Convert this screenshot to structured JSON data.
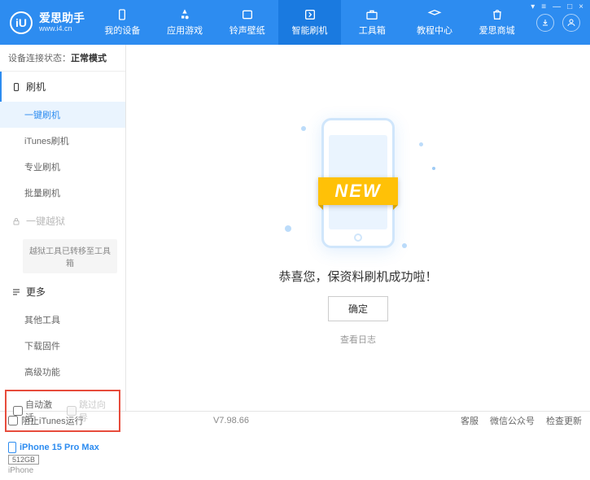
{
  "header": {
    "logo_name": "爱思助手",
    "logo_url": "www.i4.cn",
    "logo_letter": "iU",
    "nav": [
      {
        "label": "我的设备"
      },
      {
        "label": "应用游戏"
      },
      {
        "label": "铃声壁纸"
      },
      {
        "label": "智能刷机"
      },
      {
        "label": "工具箱"
      },
      {
        "label": "教程中心"
      },
      {
        "label": "爱思商城"
      }
    ],
    "window_controls": [
      "▾",
      "≡",
      "—",
      "□",
      "×"
    ]
  },
  "sidebar": {
    "status_label": "设备连接状态：",
    "status_value": "正常模式",
    "sections": {
      "flash": {
        "title": "刷机",
        "items": [
          "一键刷机",
          "iTunes刷机",
          "专业刷机",
          "批量刷机"
        ]
      },
      "jailbreak": {
        "title": "一键越狱",
        "note": "越狱工具已转移至工具箱"
      },
      "more": {
        "title": "更多",
        "items": [
          "其他工具",
          "下载固件",
          "高级功能"
        ]
      }
    },
    "checkboxes": {
      "auto_activate": "自动激活",
      "skip_guide": "跳过向导"
    },
    "device": {
      "name": "iPhone 15 Pro Max",
      "storage": "512GB",
      "type": "iPhone"
    }
  },
  "main": {
    "ribbon": "NEW",
    "success_text": "恭喜您，保资料刷机成功啦！",
    "confirm": "确定",
    "log_link": "查看日志"
  },
  "footer": {
    "block_itunes": "阻止iTunes运行",
    "version": "V7.98.66",
    "links": [
      "客服",
      "微信公众号",
      "检查更新"
    ]
  }
}
